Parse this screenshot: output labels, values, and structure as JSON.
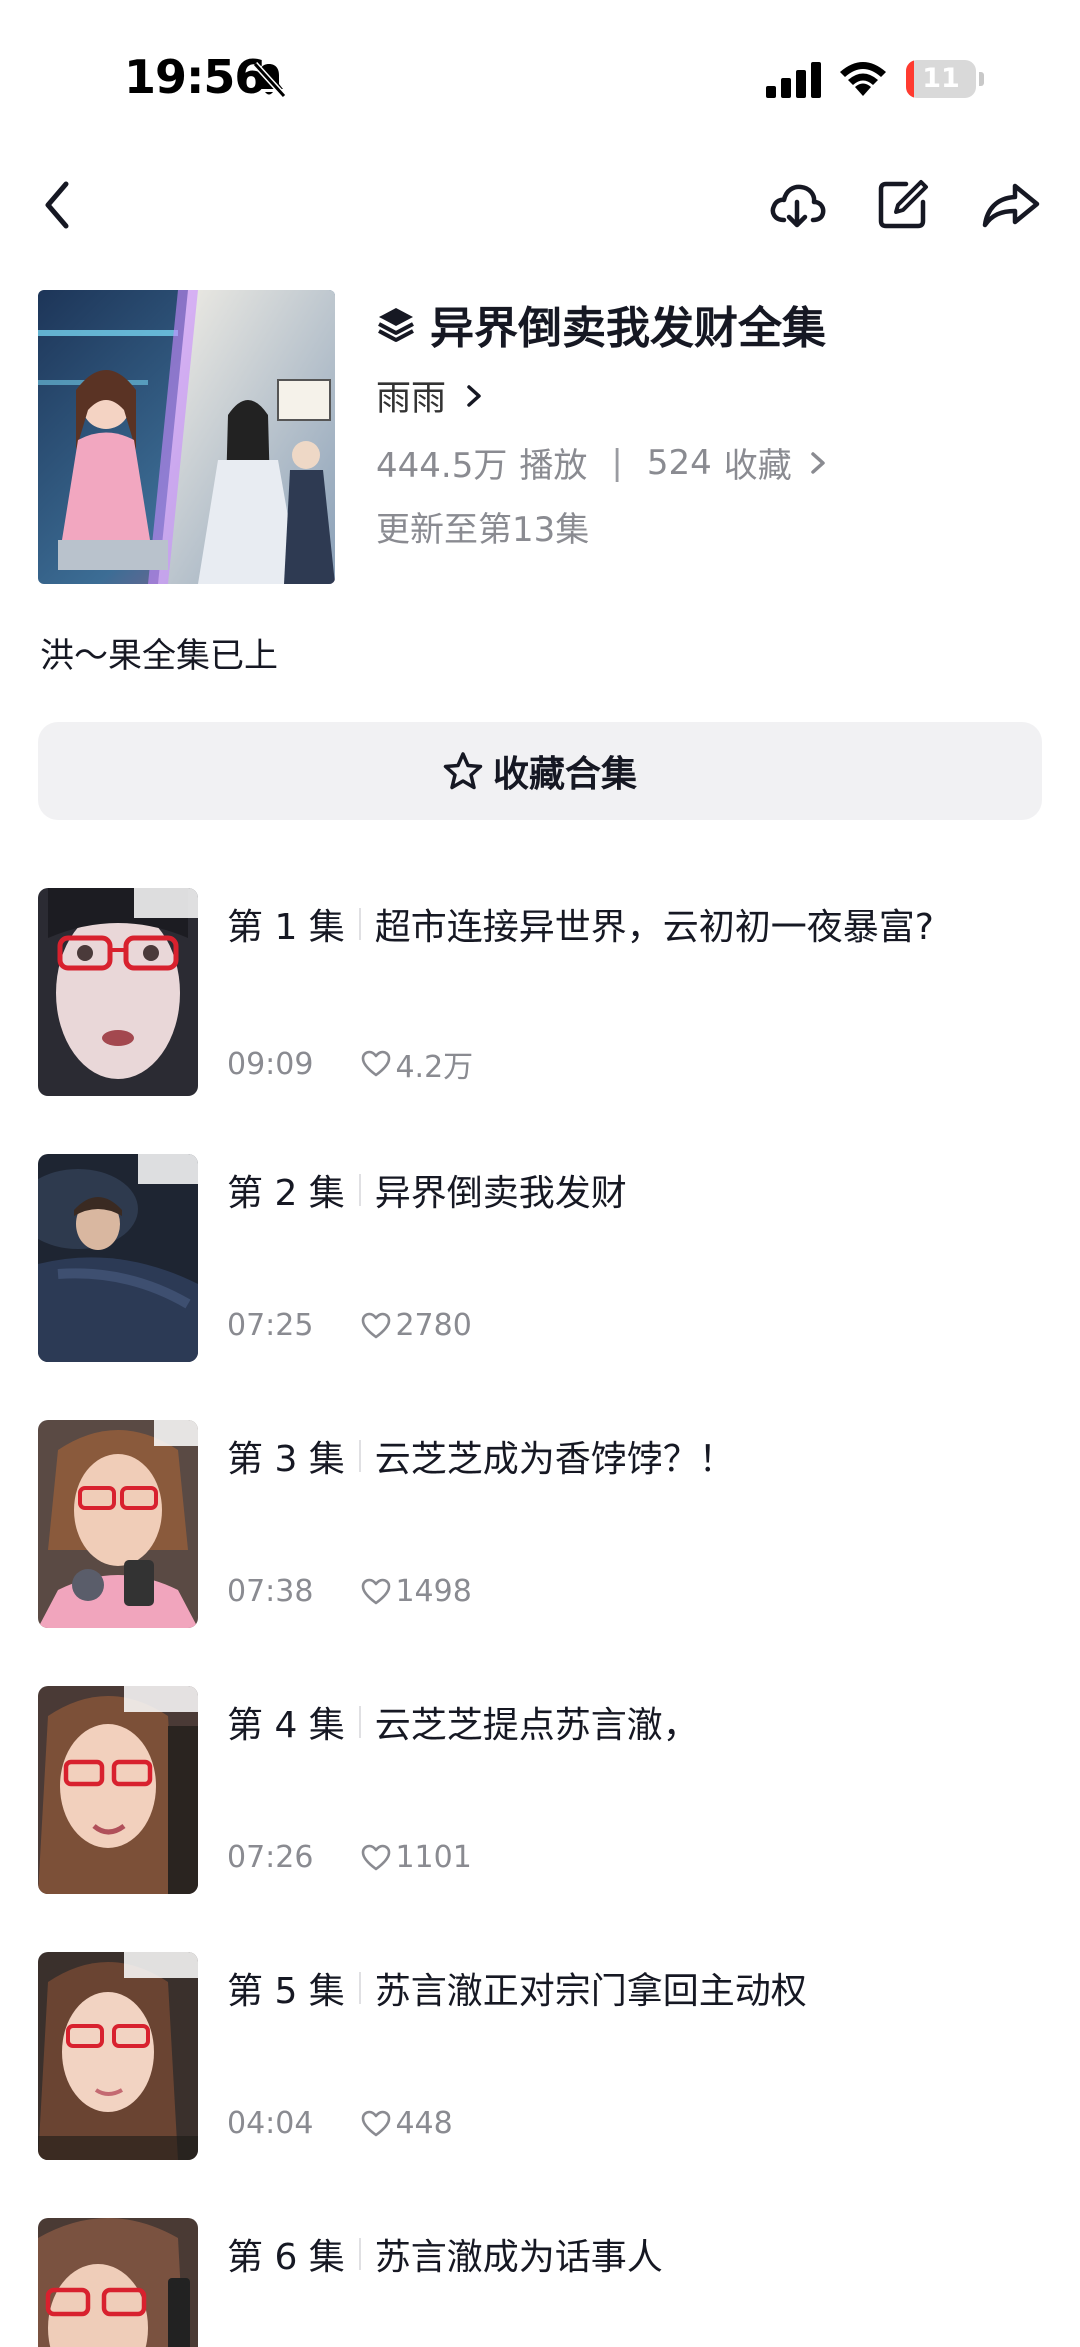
{
  "status_bar": {
    "time": "19:56",
    "battery_level": "11",
    "battery_fraction": 0.11,
    "battery_color": "#ff3b30",
    "icons": [
      "bell-slash-icon",
      "cellular-signal-icon",
      "wifi-icon",
      "battery-icon"
    ]
  },
  "nav": {
    "icons": [
      "chevron-left-icon",
      "cloud-download-icon",
      "edit-icon",
      "share-icon"
    ]
  },
  "collection": {
    "title": "异界倒卖我发财全集",
    "author": "雨雨",
    "plays": "444.5万",
    "plays_label": "播放",
    "divider": "|",
    "favorites": "524",
    "favorites_label": "收藏",
    "update_status": "更新至第13集",
    "description": "洪～果全集已上",
    "collect_button_label": "收藏合集"
  },
  "episodes": [
    {
      "number": "第 1 集",
      "title": "超市连接异世界，云初初一夜暴富?",
      "duration": "09:09",
      "likes": "4.2万"
    },
    {
      "number": "第 2 集",
      "title": "异界倒卖我发财",
      "duration": "07:25",
      "likes": "2780"
    },
    {
      "number": "第 3 集",
      "title": "云芝芝成为香饽饽？！",
      "duration": "07:38",
      "likes": "1498"
    },
    {
      "number": "第 4 集",
      "title": "云芝芝提点苏言澈，",
      "duration": "07:26",
      "likes": "1101"
    },
    {
      "number": "第 5 集",
      "title": "苏言澈正对宗门拿回主动权",
      "duration": "04:04",
      "likes": "448"
    },
    {
      "number": "第 6 集",
      "title": "苏言澈成为话事人",
      "duration": "",
      "likes": ""
    }
  ]
}
